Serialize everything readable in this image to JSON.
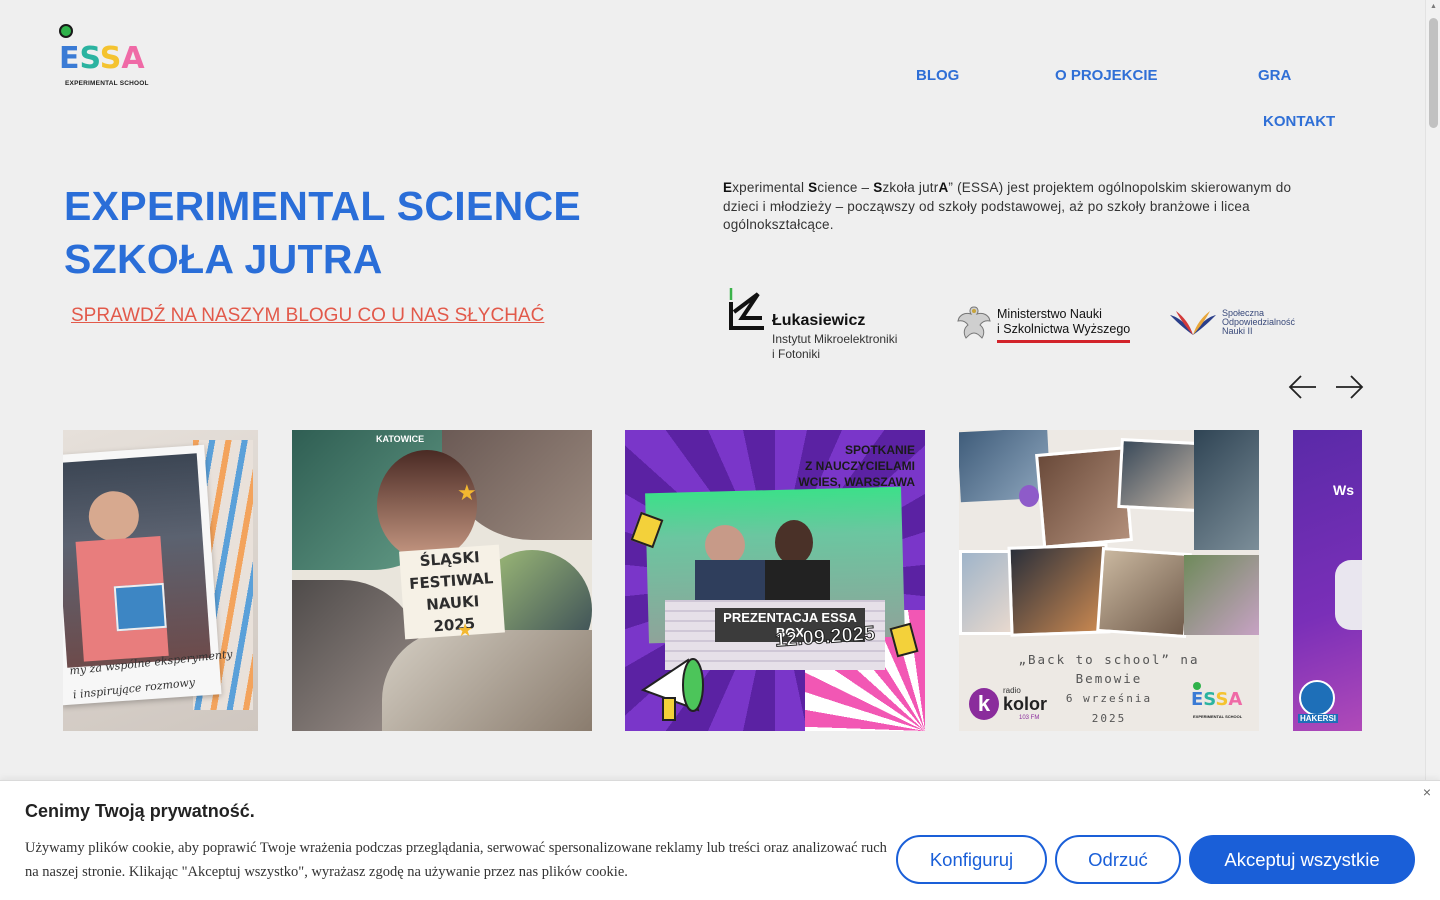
{
  "logo": {
    "word": [
      "E",
      "S",
      "S",
      "A"
    ],
    "tagline": "EXPERIMENTAL SCHOOL"
  },
  "nav": {
    "items": [
      "BLOG",
      "O PROJEKCIE",
      "GRA",
      "KONTAKT"
    ]
  },
  "hero": {
    "title_line1": "EXPERIMENTAL SCIENCE",
    "title_line2": "SZKOŁA JUTRA",
    "blog_link": "SPRAWDŹ NA NASZYM BLOGU CO U NAS SŁYCHAĆ",
    "description": {
      "p1": "E",
      "p2": "xperimental ",
      "p3": "S",
      "p4": "cience – ",
      "p5": "S",
      "p6": "zkoła jutr",
      "p7": "A",
      "p8": "” (ESSA) jest projektem ogólnopolskim skierowanym do dzieci i młodzieży – począwszy od szkoły podstawowej, aż po szkoły branżowe i licea ogólnokształcące."
    }
  },
  "partners": {
    "lukasiewicz": {
      "name": "Łukasiewicz",
      "line1": "Instytut Mikroelektroniki",
      "line2": "i Fotoniki"
    },
    "ministry": {
      "line1": "Ministerstwo Nauki",
      "line2": "i Szkolnictwa Wyższego"
    },
    "spoleczna": {
      "line1": "Społeczna",
      "line2": "Odpowiedzialność",
      "line3": "Nauki II"
    }
  },
  "carousel": {
    "slides": [
      {
        "caption": "my za wspólne eksperymenty",
        "caption2": "i inspirujące rozmowy"
      },
      {
        "caption": "ŚLĄSKI FESTIWAL NAUKI 2025",
        "place": "KATOWICE"
      },
      {
        "caption": "PREZENTACJA ESSA BOX",
        "date": "12.09.2025",
        "top1": "SPOTKANIE",
        "top2": "Z NAUCZYCIELAMI",
        "top3": "WCIES, WARSZAWA"
      },
      {
        "caption": "„Back to school” na",
        "caption2": "Bemowie",
        "caption3": "6 września",
        "caption4": "2025",
        "radio1": "radio",
        "radio2": "kolor",
        "radio3": "103 FM",
        "logo_tag": "EXPERIMENTAL SCHOOL"
      },
      {
        "partial": "Ws",
        "badge": "HAKERSI"
      }
    ]
  },
  "cookie": {
    "title": "Cenimy Twoją prywatność.",
    "text": "Używamy plików cookie, aby poprawić Twoje wrażenia podczas przeglądania, serwować spersonalizowane reklamy lub treści oraz analizować ruch na naszej stronie. Klikając \"Akceptuj wszystko\", wyrażasz zgodę na używanie przez nas plików cookie.",
    "configure": "Konfiguruj",
    "reject": "Odrzuć",
    "accept": "Akceptuj wszystkie",
    "close": "×"
  },
  "colors": {
    "brand_blue": "#2a6ed8",
    "link_red": "#e2594a",
    "button_blue": "#1a5fd8"
  }
}
